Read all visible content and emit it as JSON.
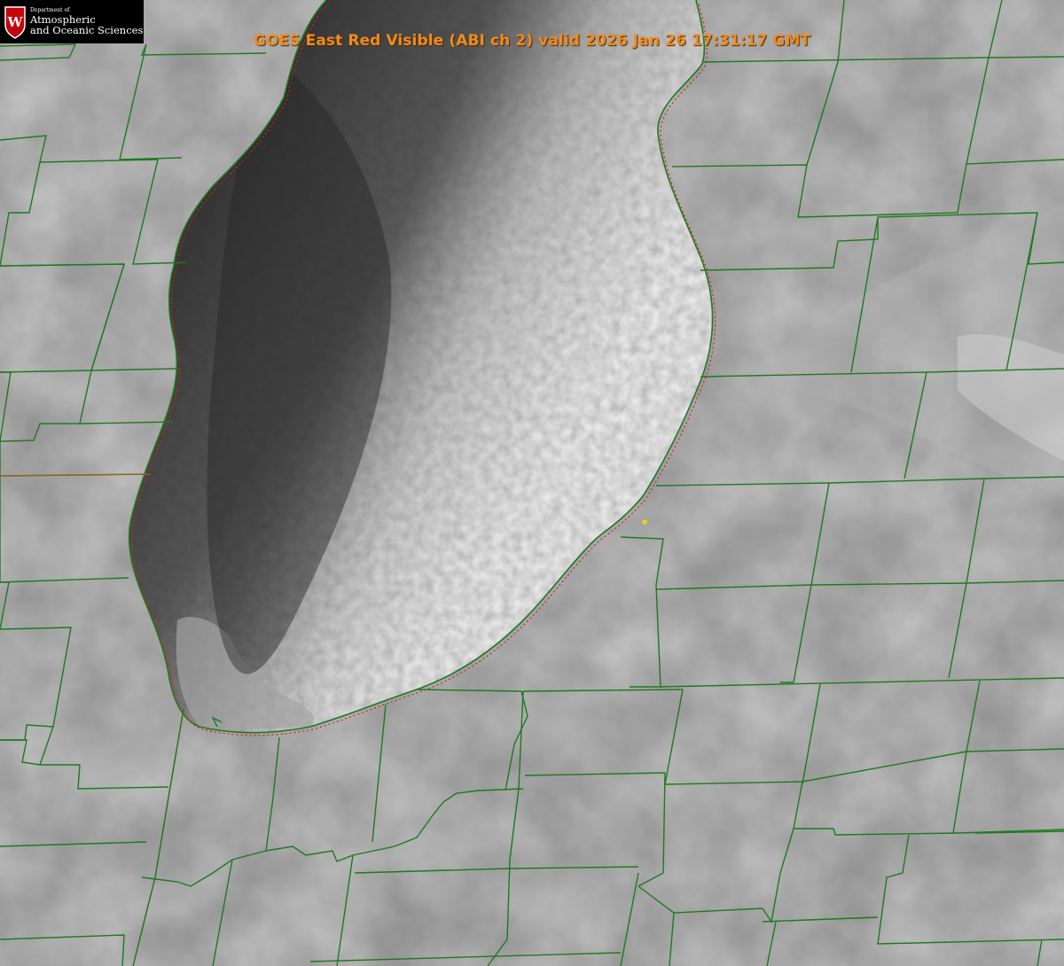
{
  "header": {
    "title": "GOES East Red Visible (ABI ch 2) valid 2026 Jan 26 17:31:17 GMT"
  },
  "logo": {
    "institution_small": "Department of",
    "institution_line1": "Atmospheric",
    "institution_line2": "and Oceanic Sciences",
    "crest_letter": "W"
  },
  "colors": {
    "county_border": "#1e7a1e",
    "state_border": "#c0531a",
    "shoreline": "#d42020",
    "marker": "#e6d21a",
    "title": "#f08a1e",
    "land": "#8c8c8c",
    "lake_dark": "#3b3b3b",
    "lake_cloud": "#a9a9a9"
  }
}
